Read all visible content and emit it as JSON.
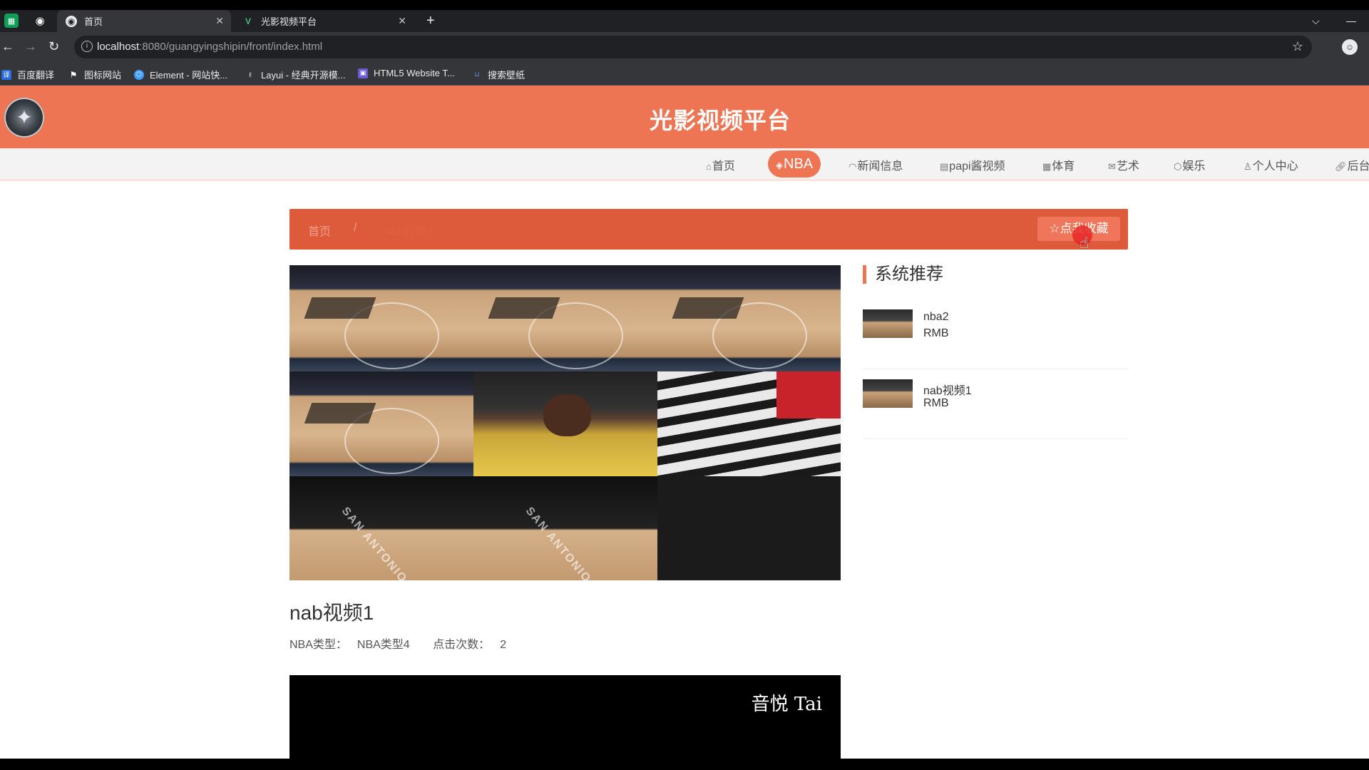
{
  "browser": {
    "tabs": [
      {
        "title": "首页",
        "active": true
      },
      {
        "title": "光影视频平台",
        "active": false
      }
    ],
    "url_host": "localhost",
    "url_path": ":8080/guangyingshipin/front/index.html",
    "bookmarks": [
      {
        "label": "百度翻译"
      },
      {
        "label": "图标网站"
      },
      {
        "label": "Element - 网站快..."
      },
      {
        "label": "Layui - 经典开源模..."
      },
      {
        "label": "HTML5 Website T..."
      },
      {
        "label": "搜索壁纸"
      }
    ]
  },
  "site": {
    "title": "光影视频平台",
    "accent": "#ee7554"
  },
  "nav": {
    "items": [
      {
        "label": "首页",
        "icon": "home-icon",
        "active": false
      },
      {
        "label": "NBA",
        "icon": "cube-icon",
        "active": true
      },
      {
        "label": "新闻信息",
        "icon": "dashboard-icon",
        "active": false
      },
      {
        "label": "papi酱视频",
        "icon": "film-icon",
        "active": false
      },
      {
        "label": "体育",
        "icon": "grid-icon",
        "active": false
      },
      {
        "label": "艺术",
        "icon": "mail-icon",
        "active": false
      },
      {
        "label": "娱乐",
        "icon": "shield-icon",
        "active": false
      },
      {
        "label": "个人中心",
        "icon": "user-icon",
        "active": false
      },
      {
        "label": "后台",
        "icon": "link-icon",
        "active": false
      }
    ]
  },
  "breadcrumb": {
    "home": "首页",
    "separator": "/",
    "current": "nab视频1",
    "favorite_label": "点我收藏"
  },
  "sidebar": {
    "heading": "系统推荐",
    "items": [
      {
        "name": "nba2",
        "price": "RMB"
      },
      {
        "name": "nab视频1",
        "price": "RMB"
      }
    ]
  },
  "video": {
    "title": "nab视频1",
    "type_label": "NBA类型：",
    "type_value": "NBA类型4",
    "clicks_label": "点击次数：",
    "clicks_value": "2",
    "watermark": "音悦 Tai"
  }
}
